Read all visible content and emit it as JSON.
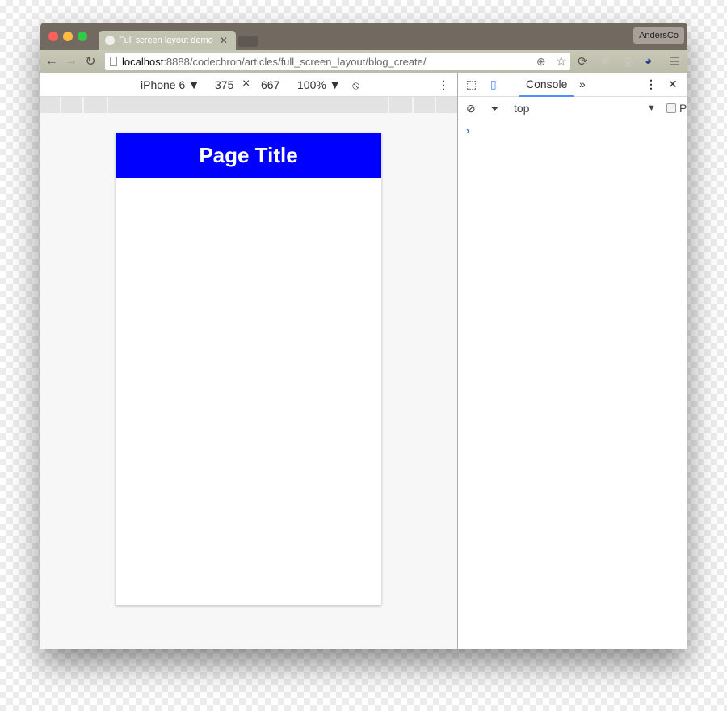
{
  "browser": {
    "tab_title": "Full screen layout demo",
    "profile": "AndersCo",
    "url_host": "localhost",
    "url_rest": ":8888/codechron/articles/full_screen_layout/blog_create/"
  },
  "device_toolbar": {
    "device": "iPhone 6",
    "width": "375",
    "times": "×",
    "height": "667",
    "zoom": "100%"
  },
  "page": {
    "title": "Page Title",
    "header_color": "#0000ff"
  },
  "devtools": {
    "tab": "Console",
    "more": "»",
    "context": "top",
    "checkbox_label": "P",
    "prompt": "›"
  }
}
